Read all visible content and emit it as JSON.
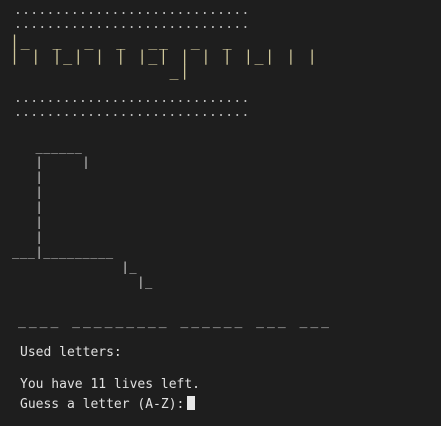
{
  "colors": {
    "background": "#1e1e1e",
    "title_art": "#cfc79a",
    "text": "#e0e0e0"
  },
  "banner": {
    "dots_top": ".............................\n.............................",
    "title_art": "|_  _  _  _  __  _  _\n| | |_| | | |_| | | | |_| | |\n               _|",
    "dots_bottom": ".............................\n............................."
  },
  "gallows_art": "   ______\n   |     |\n   |\n   |\n   |\n   |\n   |\n___|_________\n              |_\n                |_",
  "word_blanks": "____ _________ ______ ___ ___",
  "status": {
    "used_letters_label": "Used letters:",
    "lives_message": "You have 11 lives left.",
    "prompt": "Guess a letter (A-Z):"
  }
}
